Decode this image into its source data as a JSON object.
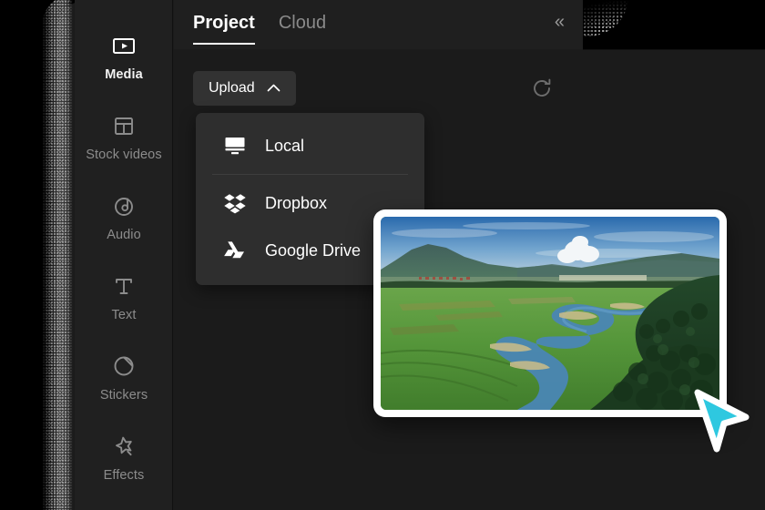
{
  "app": {
    "accent_cursor_color": "#2ec8e0",
    "panel_bg": "#1b1b1b",
    "sidebar_bg": "#202020",
    "dropdown_bg": "#2e2e2e",
    "upload_button_bg": "#323232"
  },
  "sidebar": {
    "items": [
      {
        "label": "Media",
        "icon": "media-play-rectangle-icon",
        "active": true
      },
      {
        "label": "Stock videos",
        "icon": "layout-grid-icon",
        "active": false
      },
      {
        "label": "Audio",
        "icon": "audio-note-circle-icon",
        "active": false
      },
      {
        "label": "Text",
        "icon": "text-t-icon",
        "active": false
      },
      {
        "label": "Stickers",
        "icon": "sticker-peel-icon",
        "active": false
      },
      {
        "label": "Effects",
        "icon": "effects-star-sparkle-icon",
        "active": false
      }
    ]
  },
  "tabs": {
    "items": [
      {
        "label": "Project",
        "active": true
      },
      {
        "label": "Cloud",
        "active": false
      }
    ],
    "collapse_label": "«"
  },
  "toolbar": {
    "upload_label": "Upload",
    "upload_chevron": "chevron-up-icon",
    "refresh_icon": "refresh-icon"
  },
  "upload_menu": {
    "open": true,
    "items": [
      {
        "label": "Local",
        "icon": "monitor-icon"
      },
      {
        "label": "Dropbox",
        "icon": "dropbox-icon"
      },
      {
        "label": "Google Drive",
        "icon": "google-drive-icon"
      }
    ]
  },
  "media_preview": {
    "alt": "Aerial landscape photo of a green valley with a winding river, distant mountains and a forest",
    "sky_color": "#2f6fae",
    "grass_color": "#4e9234",
    "water_color": "#3f7fb0",
    "forest_color": "#1d3d1c"
  },
  "pointer": {
    "name": "cursor-arrow",
    "color": "#2ec8e0",
    "outline": "#ffffff"
  }
}
